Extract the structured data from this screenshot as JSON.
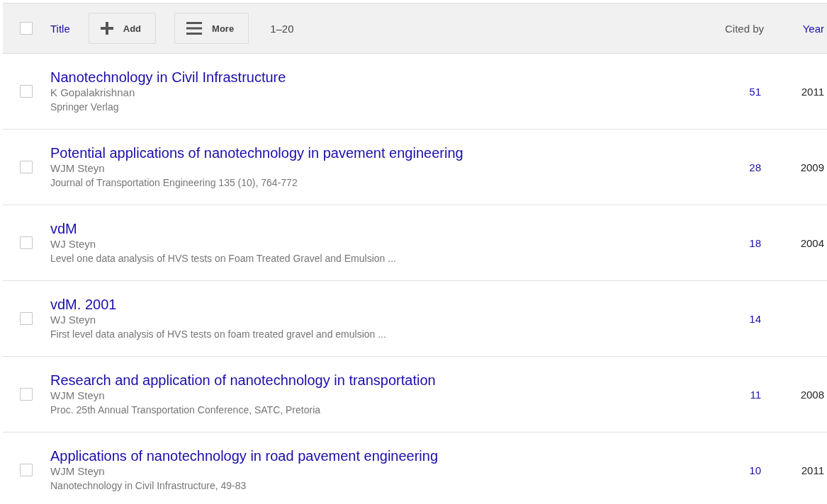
{
  "header": {
    "select_all_checked": false,
    "title_label": "Title",
    "add_button": "Add",
    "more_button": "More",
    "range": "1–20",
    "cited_by_label": "Cited by",
    "year_label": "Year"
  },
  "rows": [
    {
      "checked": false,
      "title": "Nanotechnology in Civil Infrastructure",
      "authors": "K Gopalakrishnan",
      "venue": "Springer Verlag",
      "cited_by": "51",
      "year": "2011"
    },
    {
      "checked": false,
      "title": "Potential applications of nanotechnology in pavement engineering",
      "authors": "WJM Steyn",
      "venue": "Journal of Transportation Engineering 135 (10), 764-772",
      "cited_by": "28",
      "year": "2009"
    },
    {
      "checked": false,
      "title": "vdM",
      "authors": "WJ Steyn",
      "venue": "Level one data analysis of HVS tests on Foam Treated Gravel and Emulsion ...",
      "cited_by": "18",
      "year": "2004"
    },
    {
      "checked": false,
      "title": "vdM. 2001",
      "authors": "WJ Steyn",
      "venue": "First level data analysis of HVS tests on foam treated gravel and emulsion ...",
      "cited_by": "14"
    },
    {
      "checked": false,
      "title": "Research and application of nanotechnology in transportation",
      "authors": "WJM Steyn",
      "venue": "Proc. 25th Annual Transportation Conference, SATC, Pretoria",
      "cited_by": "11",
      "year": "2008"
    },
    {
      "checked": false,
      "title": "Applications of nanotechnology in road pavement engineering",
      "authors": "WJM Steyn",
      "venue": "Nanotechnology in Civil Infrastructure, 49-83",
      "cited_by": "10",
      "year": "2011"
    }
  ]
}
